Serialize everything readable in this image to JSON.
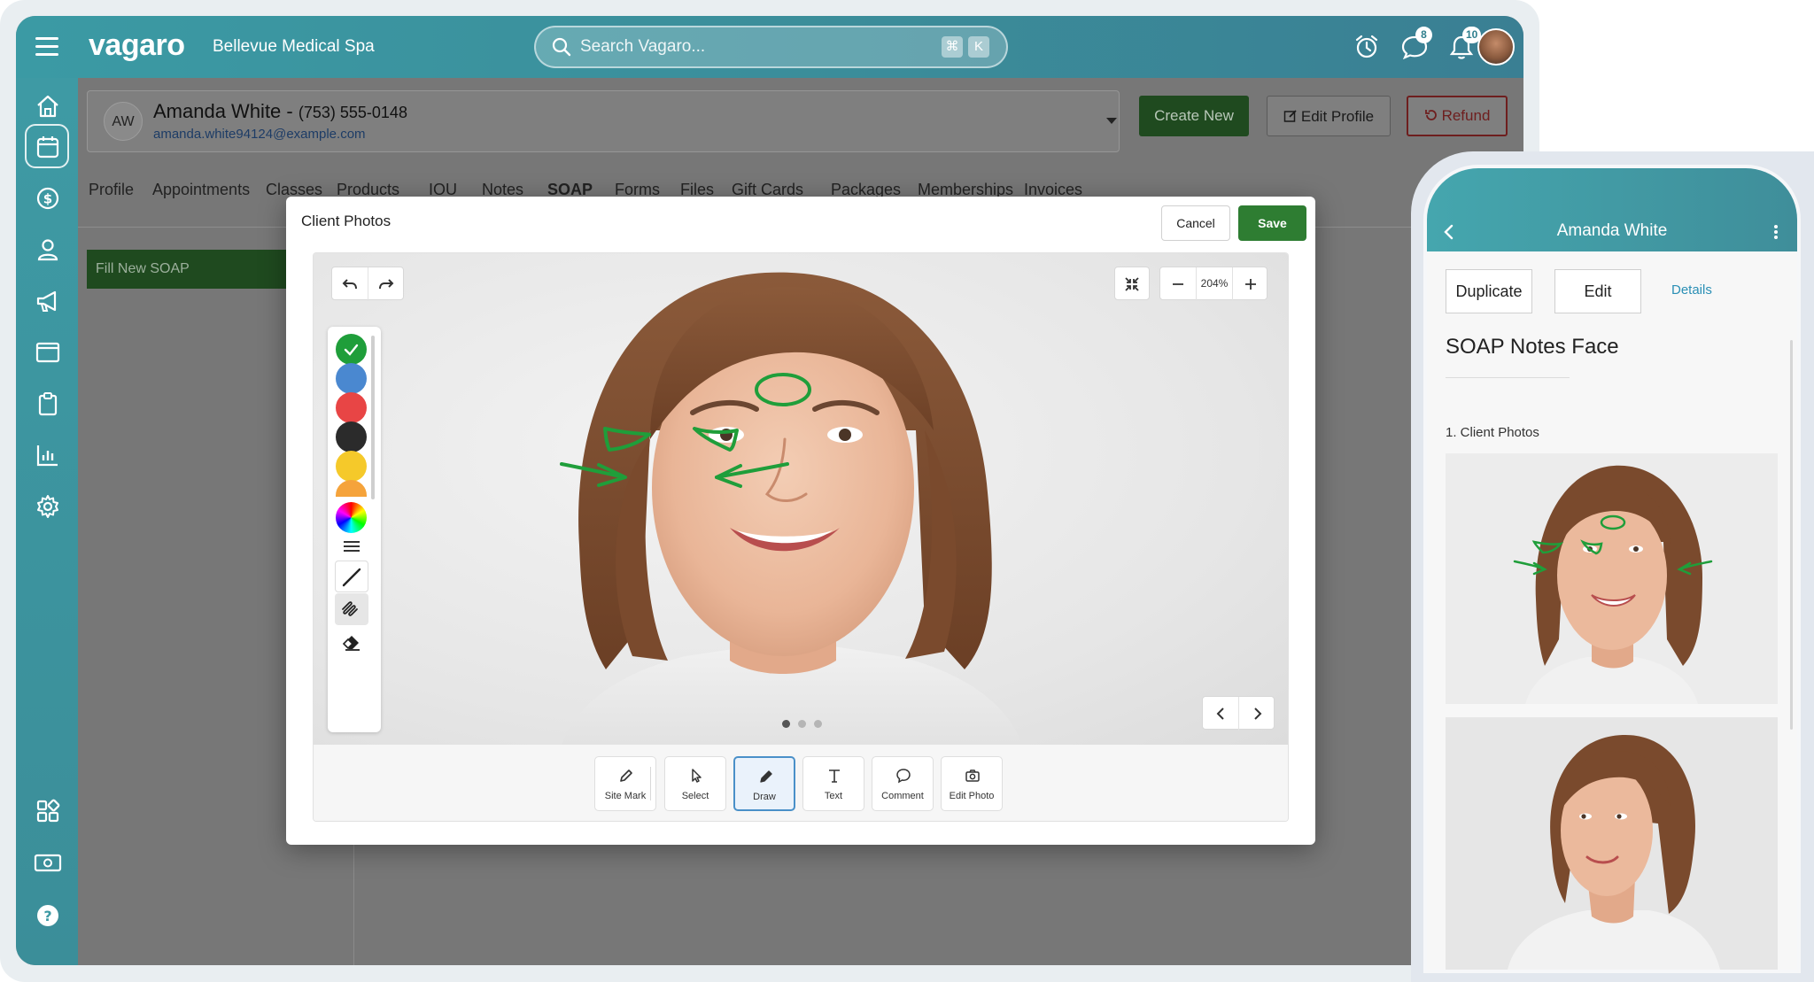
{
  "app": {
    "logo": "vagaro",
    "business_name": "Bellevue Medical Spa"
  },
  "search": {
    "placeholder": "Search Vagaro...",
    "shortcut_cmd": "⌘",
    "shortcut_key": "K"
  },
  "topbar": {
    "messages_count": "8",
    "notifications_count": "10"
  },
  "client": {
    "initials": "AW",
    "name": "Amanda White",
    "phone": "(753) 555-0148",
    "email": "amanda.white94124@example.com"
  },
  "actions": {
    "create_new": "Create New",
    "edit_profile": "Edit Profile",
    "refund": "Refund"
  },
  "tabs": [
    "Profile",
    "Appointments",
    "Classes",
    "Products",
    "IOU",
    "Notes",
    "SOAP",
    "Forms",
    "Files",
    "Gift Cards",
    "Packages",
    "Memberships",
    "Invoices"
  ],
  "active_tab": "SOAP",
  "fill_soap": "Fill New SOAP",
  "modal": {
    "title": "Client Photos",
    "cancel": "Cancel",
    "save": "Save",
    "zoom": "204%",
    "palette_colors": [
      "#1f9e3a",
      "#4a88d0",
      "#e84545",
      "#2b2b2b",
      "#f5c92a",
      "#f5a33b"
    ],
    "tools": [
      {
        "label": "Site Mark",
        "icon": "pencil-icon"
      },
      {
        "label": "Select",
        "icon": "cursor-icon"
      },
      {
        "label": "Draw",
        "icon": "pen-icon"
      },
      {
        "label": "Text",
        "icon": "text-icon"
      },
      {
        "label": "Comment",
        "icon": "comment-icon"
      },
      {
        "label": "Edit Photo",
        "icon": "camera-icon"
      }
    ],
    "active_tool": "Draw",
    "photo_count": 3,
    "current_photo": 1
  },
  "mobile": {
    "title": "Amanda White",
    "duplicate": "Duplicate",
    "edit": "Edit",
    "details": "Details",
    "form_title": "SOAP Notes Face",
    "section": "1. Client Photos"
  },
  "colors": {
    "brand_teal": "#3b8d9a",
    "save_green": "#2e7d32",
    "refund_red": "#6e1e1e",
    "annotation_green": "#1f9e3a"
  }
}
